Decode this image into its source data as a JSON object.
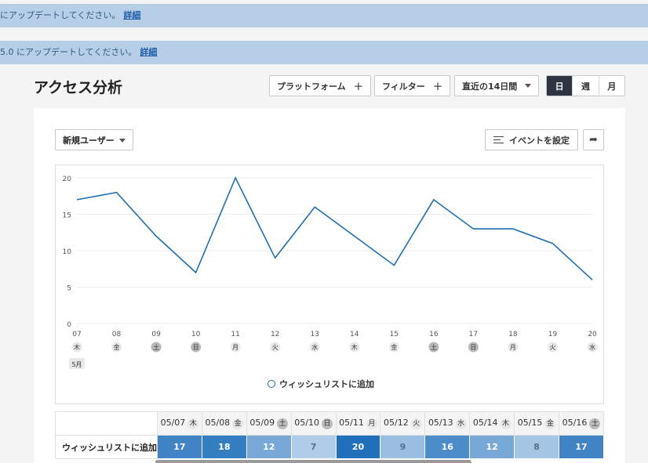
{
  "banners": [
    {
      "text": "にアップデートしてください。",
      "link": "詳細"
    },
    {
      "text": "5.0 にアップデートしてください。",
      "link": "詳細"
    }
  ],
  "page_title": "アクセス分析",
  "toolbar": {
    "platform_label": "プラットフォーム",
    "filter_label": "フィルター",
    "date_range": "直近の14日間",
    "granularity": [
      "日",
      "週",
      "月"
    ]
  },
  "metric_select": "新規ユーザー",
  "event_button": "イベントを設定",
  "icons": {
    "add": "plus-icon",
    "dropdown": "caret-down-icon",
    "event": "list-check-icon",
    "share": "share-icon"
  },
  "colors": {
    "line": "#1f6fb2",
    "selected": "#2d3542"
  },
  "chart_data": {
    "type": "line",
    "x": [
      "07",
      "08",
      "09",
      "10",
      "11",
      "12",
      "13",
      "14",
      "15",
      "16",
      "17",
      "18",
      "19",
      "20"
    ],
    "weekdays": [
      "木",
      "金",
      "土",
      "日",
      "月",
      "火",
      "水",
      "木",
      "金",
      "土",
      "日",
      "月",
      "火",
      "水"
    ],
    "weekend": [
      false,
      false,
      true,
      true,
      false,
      false,
      false,
      false,
      false,
      true,
      true,
      false,
      false,
      false
    ],
    "month_label": "5月",
    "series": [
      {
        "name": "ウィッシュリストに追加",
        "values": [
          17,
          18,
          12,
          7,
          20,
          9,
          16,
          12,
          8,
          17,
          13,
          13,
          11,
          6
        ]
      }
    ],
    "yticks": [
      0,
      5,
      10,
      15,
      20
    ],
    "ylim": [
      0,
      20
    ],
    "grid": true,
    "legend": "bottom-center"
  },
  "table": {
    "row_label": "ウィッシュリストに追加",
    "columns": [
      {
        "date": "05/07",
        "wd": "木",
        "dark": false,
        "value": 17
      },
      {
        "date": "05/08",
        "wd": "金",
        "dark": false,
        "value": 18
      },
      {
        "date": "05/09",
        "wd": "土",
        "dark": true,
        "value": 12
      },
      {
        "date": "05/10",
        "wd": "日",
        "dark": true,
        "value": 7
      },
      {
        "date": "05/11",
        "wd": "月",
        "dark": false,
        "value": 20
      },
      {
        "date": "05/12",
        "wd": "火",
        "dark": false,
        "value": 9
      },
      {
        "date": "05/13",
        "wd": "水",
        "dark": false,
        "value": 16
      },
      {
        "date": "05/14",
        "wd": "木",
        "dark": false,
        "value": 12
      },
      {
        "date": "05/15",
        "wd": "金",
        "dark": false,
        "value": 8
      },
      {
        "date": "05/16",
        "wd": "土",
        "dark": true,
        "value": 17
      }
    ]
  }
}
